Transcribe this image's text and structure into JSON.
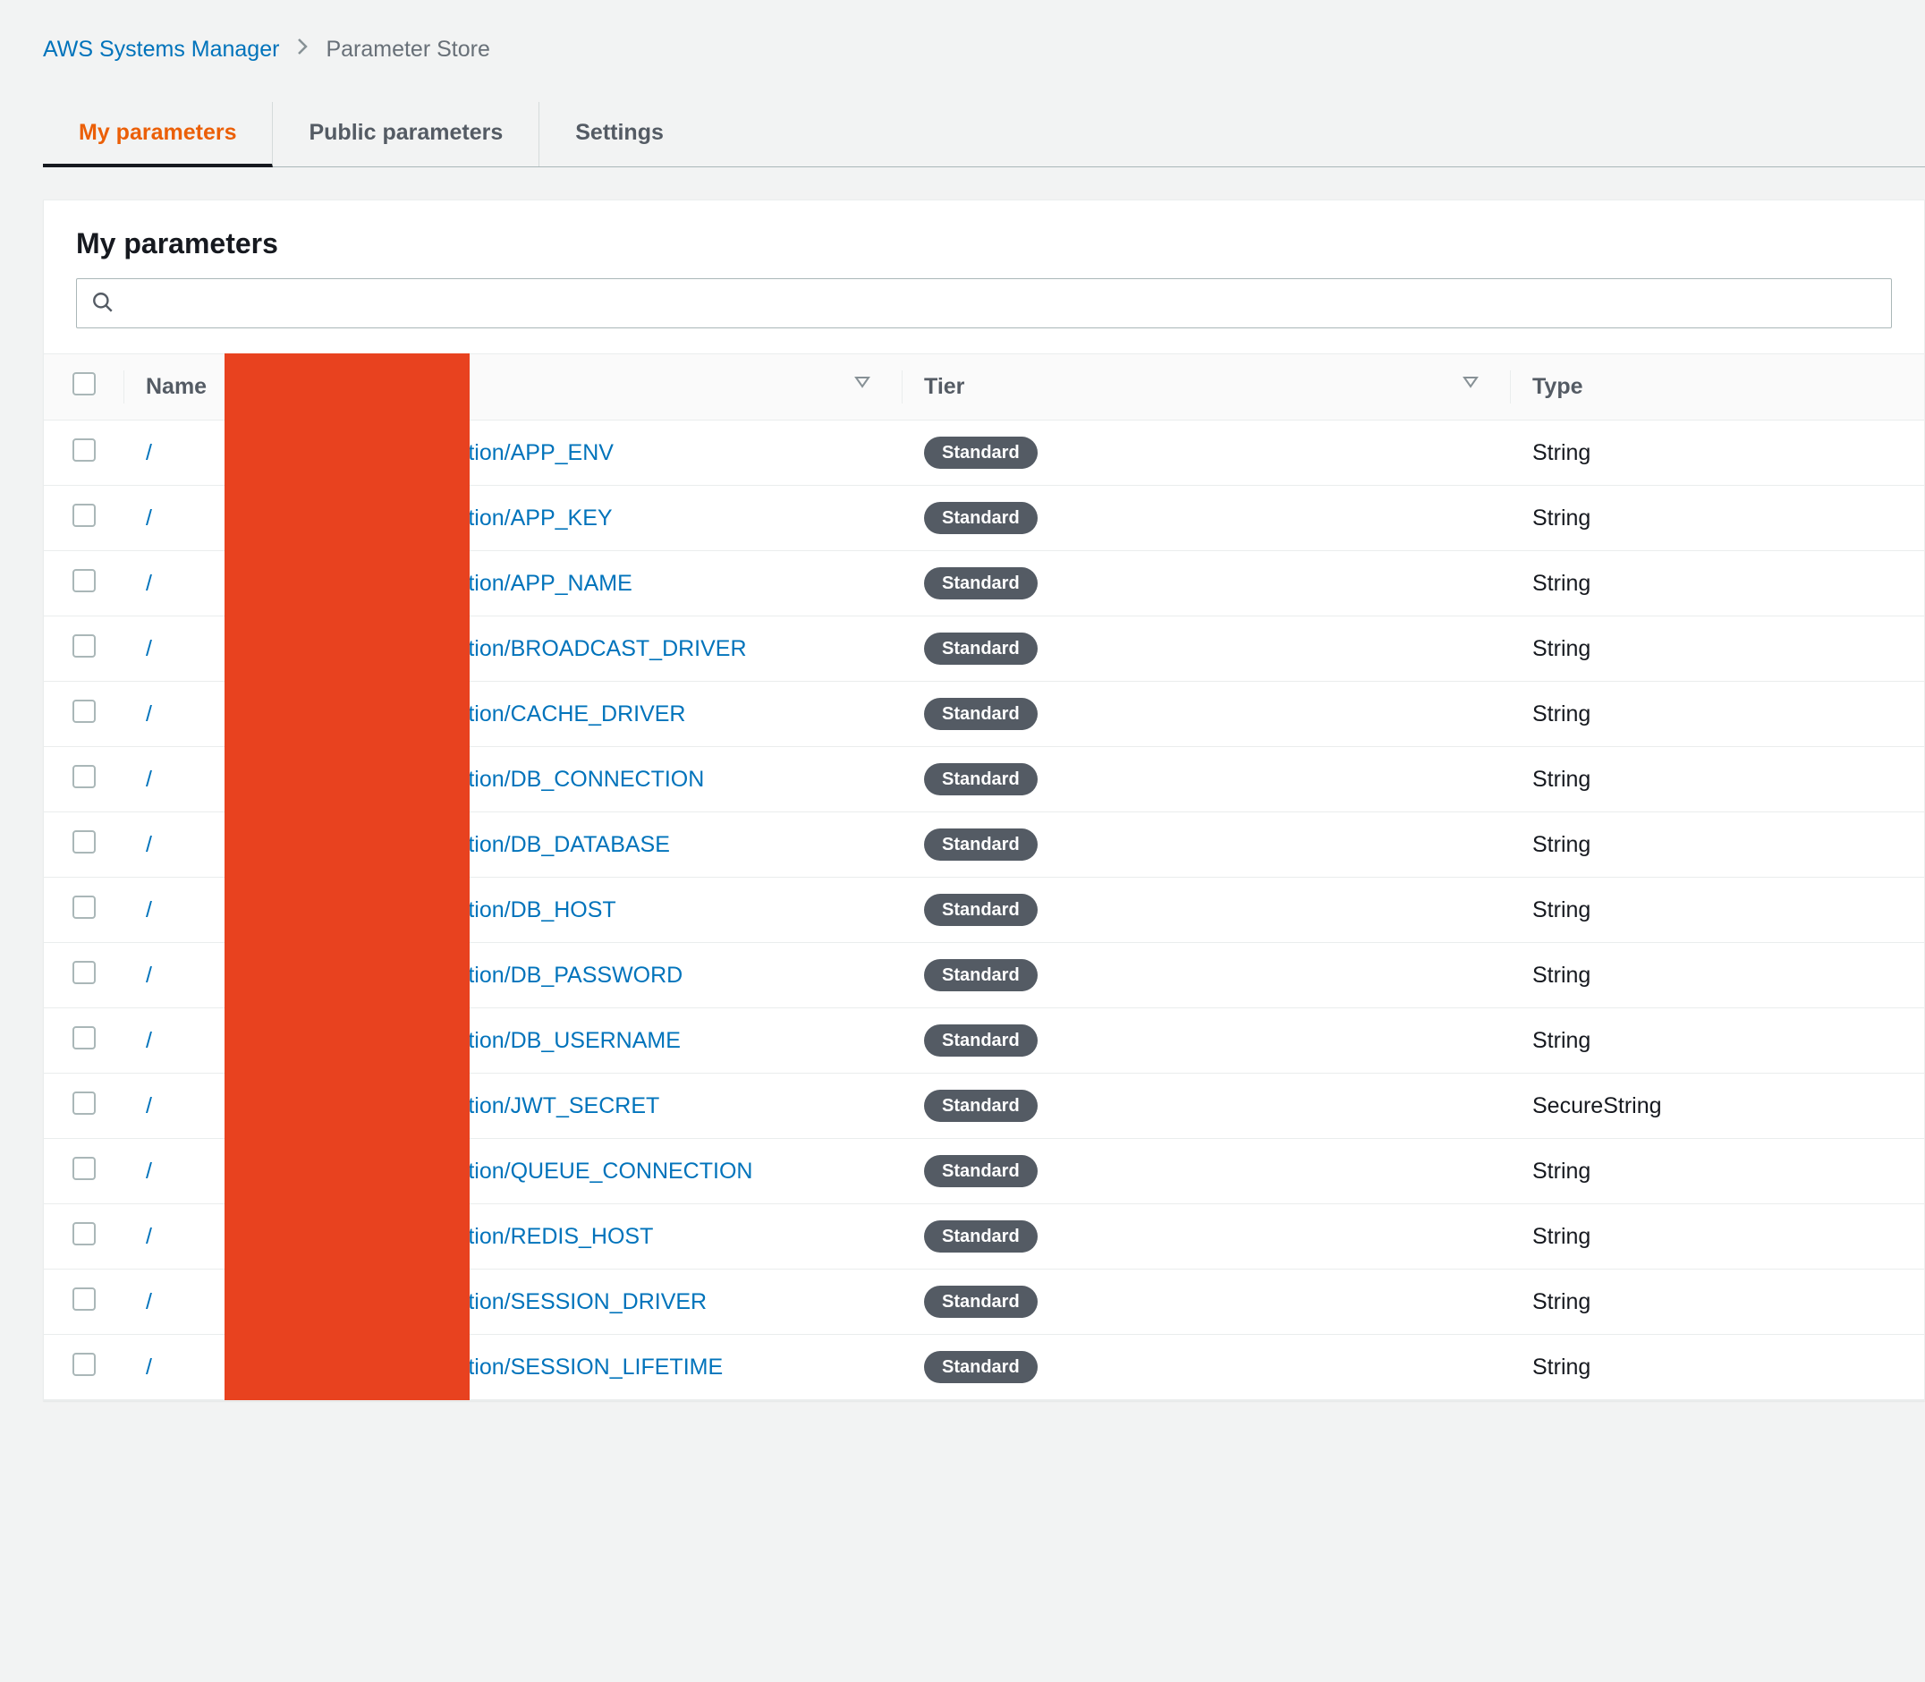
{
  "breadcrumb": {
    "root": "AWS Systems Manager",
    "current": "Parameter Store"
  },
  "tabs": [
    {
      "label": "My parameters",
      "active": true
    },
    {
      "label": "Public parameters",
      "active": false
    },
    {
      "label": "Settings",
      "active": false
    }
  ],
  "panel": {
    "title": "My parameters"
  },
  "search": {
    "placeholder": ""
  },
  "columns": {
    "name": "Name",
    "tier": "Tier",
    "type": "Type"
  },
  "tier_label": "Standard",
  "rows": [
    {
      "prefix": "/",
      "suffix": "/production/APP_ENV",
      "tier": "Standard",
      "type": "String"
    },
    {
      "prefix": "/",
      "suffix": "/production/APP_KEY",
      "tier": "Standard",
      "type": "String"
    },
    {
      "prefix": "/",
      "suffix": "/production/APP_NAME",
      "tier": "Standard",
      "type": "String"
    },
    {
      "prefix": "/",
      "suffix": "/production/BROADCAST_DRIVER",
      "tier": "Standard",
      "type": "String"
    },
    {
      "prefix": "/",
      "suffix": "/production/CACHE_DRIVER",
      "tier": "Standard",
      "type": "String"
    },
    {
      "prefix": "/",
      "suffix": "/production/DB_CONNECTION",
      "tier": "Standard",
      "type": "String"
    },
    {
      "prefix": "/",
      "suffix": "/production/DB_DATABASE",
      "tier": "Standard",
      "type": "String"
    },
    {
      "prefix": "/",
      "suffix": "/production/DB_HOST",
      "tier": "Standard",
      "type": "String"
    },
    {
      "prefix": "/",
      "suffix": "/production/DB_PASSWORD",
      "tier": "Standard",
      "type": "String"
    },
    {
      "prefix": "/",
      "suffix": "/production/DB_USERNAME",
      "tier": "Standard",
      "type": "String"
    },
    {
      "prefix": "/",
      "suffix": "/production/JWT_SECRET",
      "tier": "Standard",
      "type": "SecureString"
    },
    {
      "prefix": "/",
      "suffix": "/production/QUEUE_CONNECTION",
      "tier": "Standard",
      "type": "String"
    },
    {
      "prefix": "/",
      "suffix": "/production/REDIS_HOST",
      "tier": "Standard",
      "type": "String"
    },
    {
      "prefix": "/",
      "suffix": "/production/SESSION_DRIVER",
      "tier": "Standard",
      "type": "String"
    },
    {
      "prefix": "/",
      "suffix": "/production/SESSION_LIFETIME",
      "tier": "Standard",
      "type": "String"
    }
  ]
}
